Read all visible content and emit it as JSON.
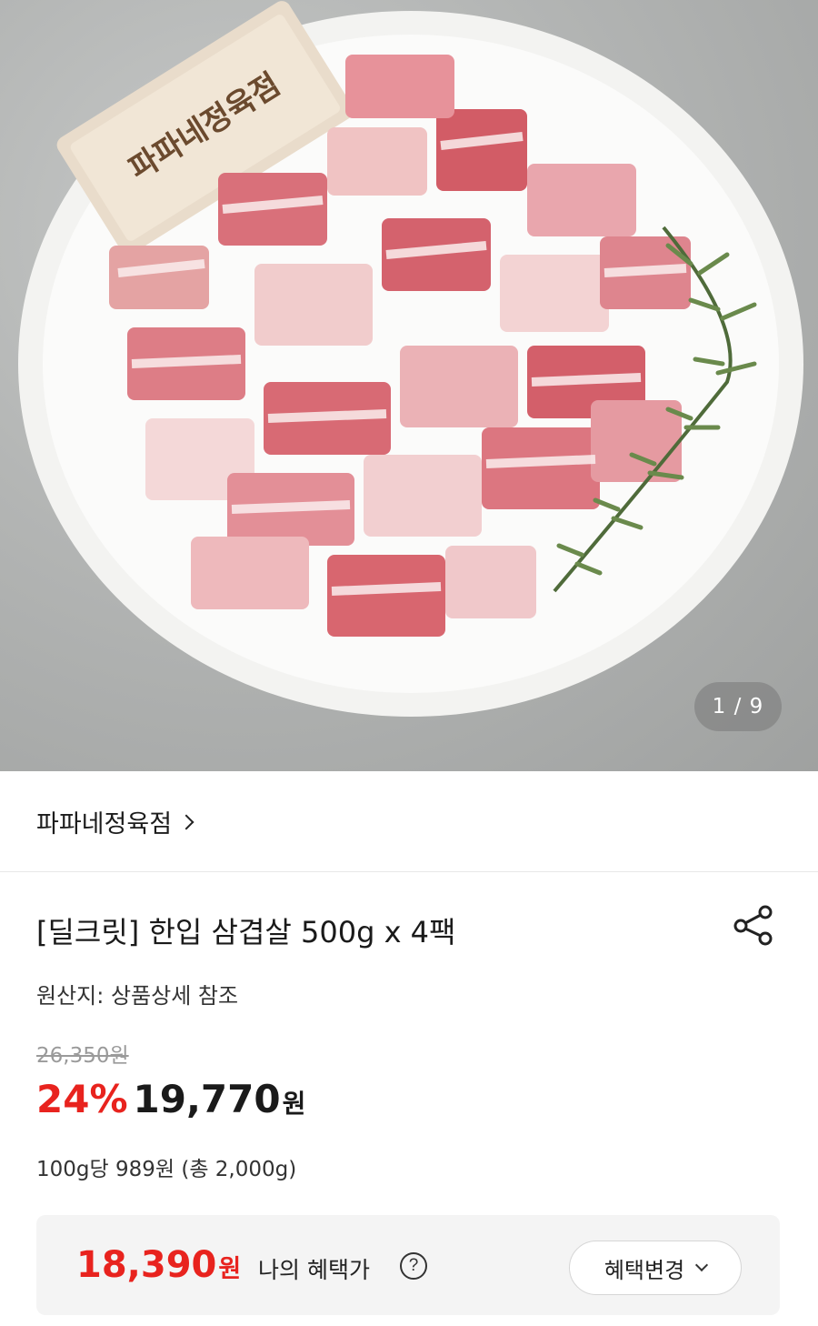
{
  "gallery": {
    "counter": "1 / 9",
    "image_alt": "product-photo-pork-belly"
  },
  "seller": {
    "name": "파파네정육점"
  },
  "product": {
    "title": "[딜크릿] 한입 삼겹살 500g x 4팩",
    "origin": "원산지: 상품상세 참조",
    "original_price": "26,350원",
    "discount": "24%",
    "sale_price": "19,770",
    "sale_unit": "원",
    "unit_price": "100g당 989원 (총 2,000g)"
  },
  "benefit": {
    "price": "18,390",
    "unit": "원",
    "label": "나의 혜택가",
    "help": "?",
    "change_label": "혜택변경"
  },
  "colors": {
    "accent_red": "#e8231e",
    "text": "#1a1a1a",
    "muted": "#9a9a9a",
    "benefit_bg": "#f4f4f4"
  }
}
